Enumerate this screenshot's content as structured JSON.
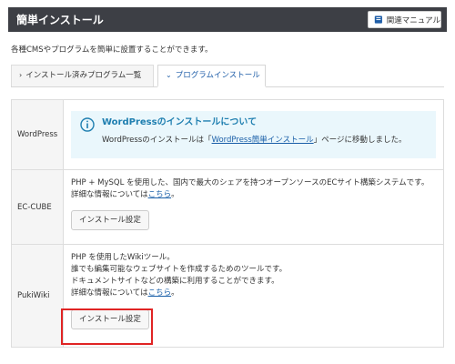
{
  "header": {
    "title": "簡単インストール",
    "manual_label": "関連マニュアル",
    "background": "#3d3f45"
  },
  "description": "各種CMSやプログラムを簡単に設置することができます。",
  "tabs": [
    {
      "label": "インストール済みプログラム一覧",
      "icon": "chevron-right-icon",
      "active": false
    },
    {
      "label": "プログラムインストール",
      "icon": "chevron-down-icon",
      "active": true
    }
  ],
  "programs": {
    "wordpress": {
      "name": "WordPress",
      "info_title": "WordPressのインストールについて",
      "info_text_before": "WordPressのインストールは「",
      "info_link": "WordPress簡単インストール",
      "info_text_after": "」ページに移動しました。"
    },
    "eccube": {
      "name": "EC-CUBE",
      "line1": "PHP + MySQL を使用した、国内で最大のシェアを持つオープンソースのECサイト構築システムです。",
      "line2_prefix": "詳細な情報については",
      "line2_link": "こちら",
      "line2_suffix": "。",
      "button_label": "インストール設定"
    },
    "pukiwiki": {
      "name": "PukiWiki",
      "line1": "PHP を使用したWikiツール。",
      "line2": "誰でも編集可能なウェブサイトを作成するためのツールです。",
      "line3": "ドキュメントサイトなどの構築に利用することができます。",
      "line4_prefix": "詳細な情報については",
      "line4_link": "こちら",
      "line4_suffix": "。",
      "button_label": "インストール設定"
    }
  },
  "colors": {
    "accent": "#1f7fb0",
    "link": "#1a5fa8",
    "info_bg": "#eaf7fc",
    "highlight": "#e02424"
  }
}
